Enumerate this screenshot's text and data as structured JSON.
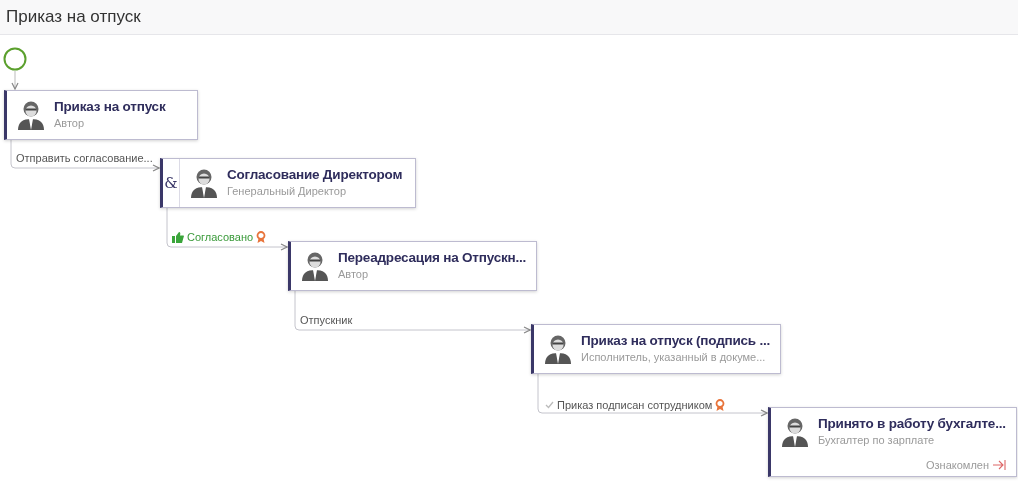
{
  "title": "Приказ на отпуск",
  "nodes": [
    {
      "title": "Приказ на отпуск",
      "role": "Автор"
    },
    {
      "title": "Согласование Директором",
      "role": "Генеральный Директор",
      "prefix": "&"
    },
    {
      "title": "Переадресация на Отпускн...",
      "role": "Автор"
    },
    {
      "title": "Приказ на отпуск (подпись ...",
      "role": "Исполнитель, указанный в докуме..."
    },
    {
      "title": "Принято в работу бухгалте...",
      "role": "Бухгалтер по зарплате",
      "status": "Ознакомлен"
    }
  ],
  "transitions": [
    {
      "label": "Отправить согласование...",
      "kind": "plain"
    },
    {
      "label": "Согласовано",
      "kind": "approved"
    },
    {
      "label": "Отпускник",
      "kind": "plain"
    },
    {
      "label": "Приказ подписан сотрудником",
      "kind": "signed"
    }
  ]
}
